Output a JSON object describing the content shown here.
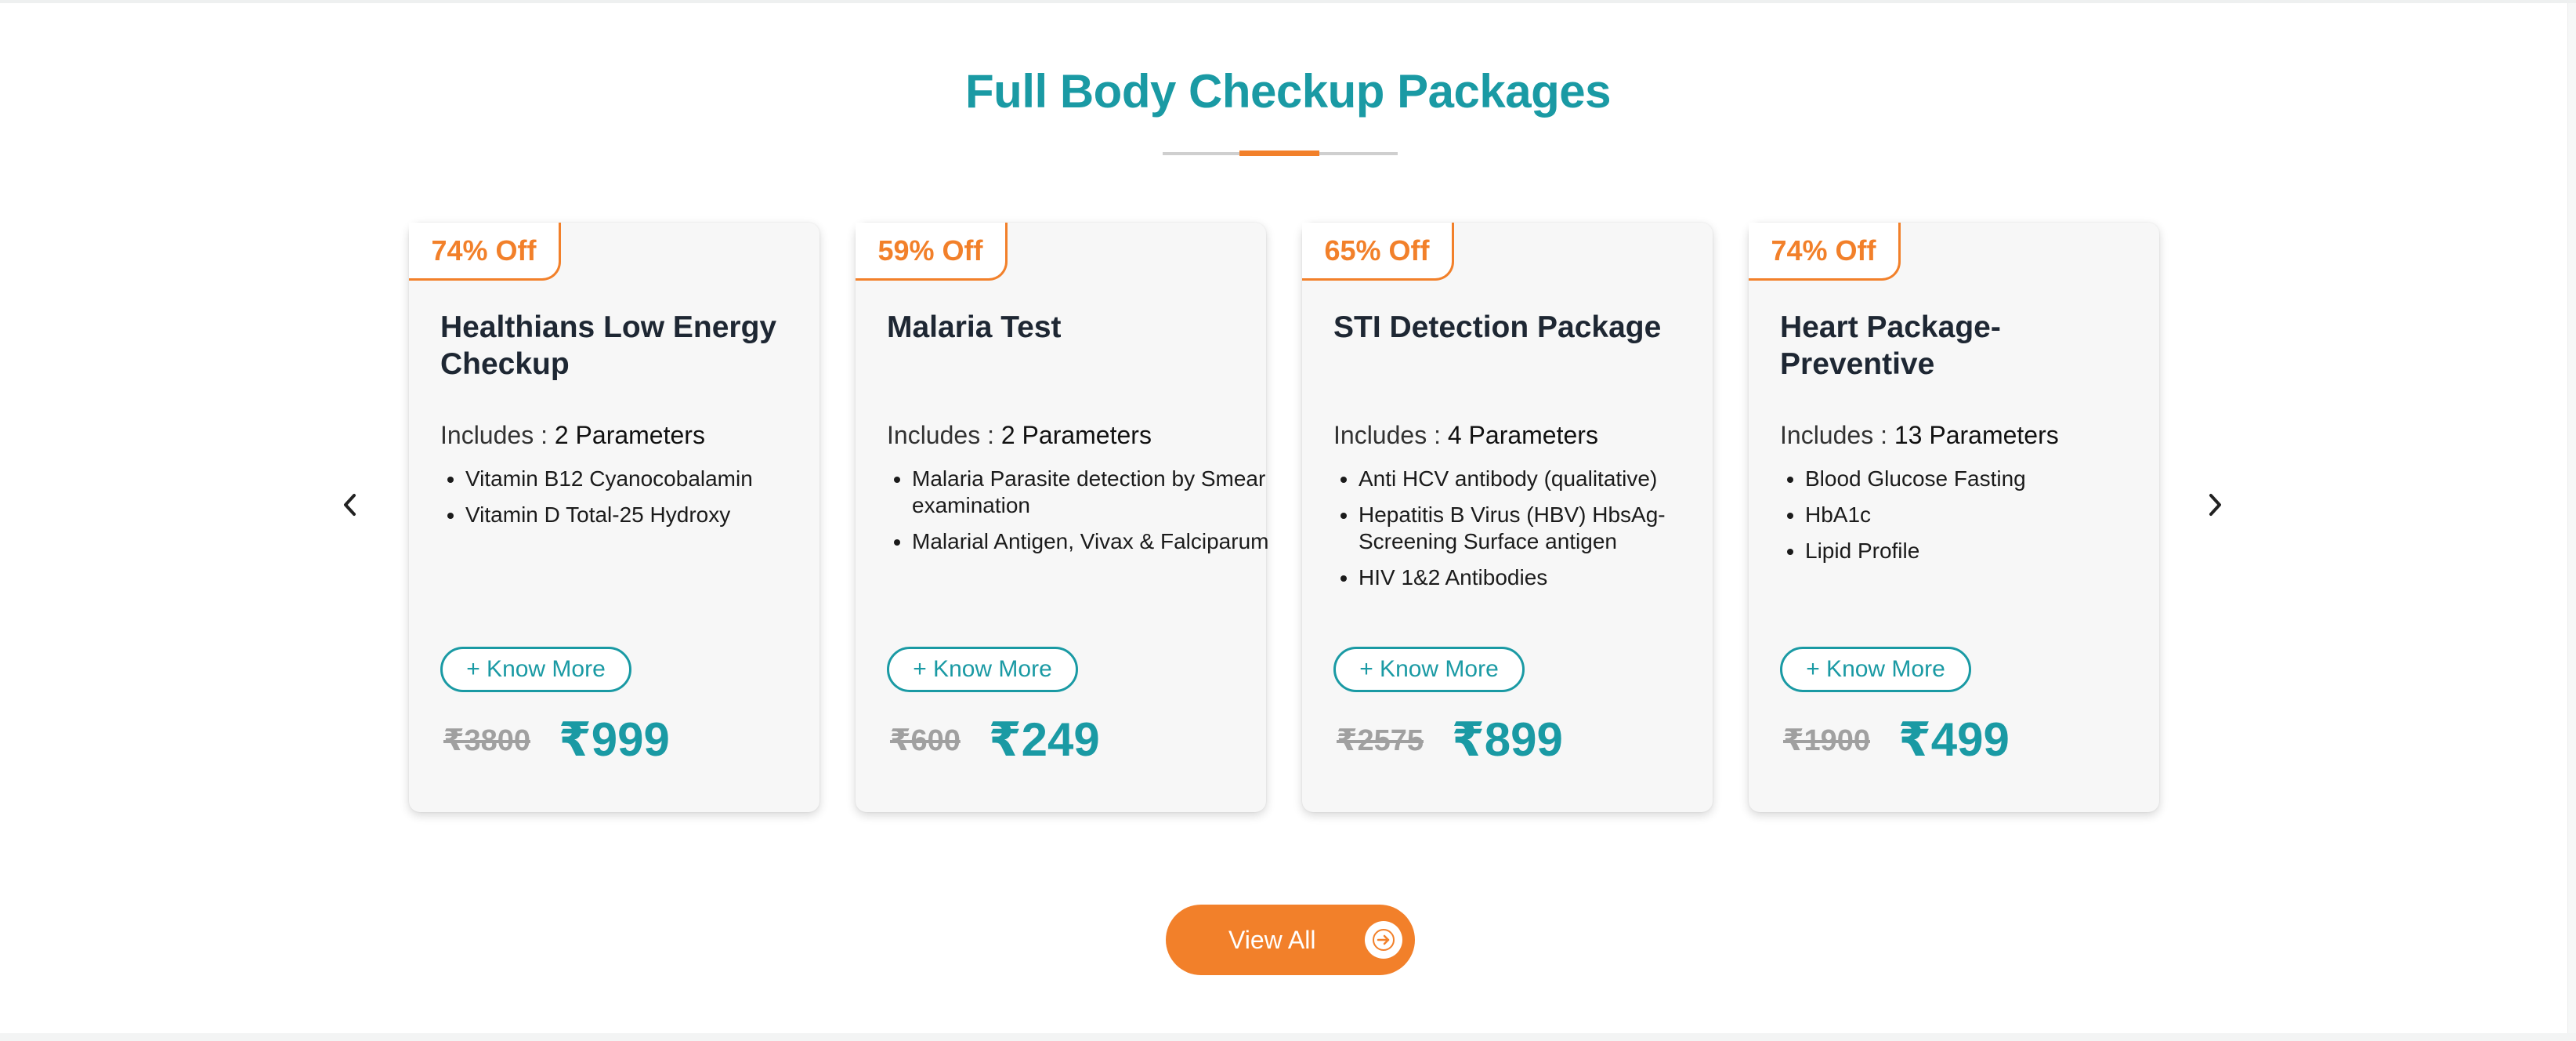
{
  "section": {
    "title": "Full Body Checkup Packages",
    "view_all_label": "View All",
    "include_label": "Includes : "
  },
  "colors": {
    "brand_teal": "#1a9aa4",
    "brand_orange": "#f2802a",
    "card_bg": "#f7f7f7"
  },
  "icons": {
    "prev": "chevron-left-icon",
    "next": "chevron-right-icon",
    "view_all": "arrow-right-circle-icon"
  },
  "packages": [
    {
      "discount": "74% Off",
      "name": "Healthians Low Energy Checkup",
      "parameters": "2 Parameters",
      "items": [
        "Vitamin B12 Cyanocobalamin",
        "Vitamin D Total-25 Hydroxy"
      ],
      "know_more": "+ Know More",
      "old_price": "₹3800",
      "new_price": "₹999"
    },
    {
      "discount": "59% Off",
      "name": "Malaria Test",
      "parameters": "2 Parameters",
      "items": [
        "Malaria Parasite detection by Smear examination",
        "Malarial Antigen, Vivax & Falciparum"
      ],
      "know_more": "+ Know More",
      "old_price": "₹600",
      "new_price": "₹249"
    },
    {
      "discount": "65% Off",
      "name": "STI Detection Package",
      "parameters": "4 Parameters",
      "items": [
        "Anti HCV antibody (qualitative)",
        "Hepatitis B Virus (HBV) HbsAg-Screening Surface antigen",
        "HIV 1&2 Antibodies"
      ],
      "know_more": "+ Know More",
      "old_price": "₹2575",
      "new_price": "₹899"
    },
    {
      "discount": "74% Off",
      "name": "Heart Package-Preventive",
      "parameters": "13 Parameters",
      "items": [
        "Blood Glucose Fasting",
        "HbA1c",
        "Lipid Profile"
      ],
      "know_more": "+ Know More",
      "old_price": "₹1900",
      "new_price": "₹499"
    }
  ]
}
